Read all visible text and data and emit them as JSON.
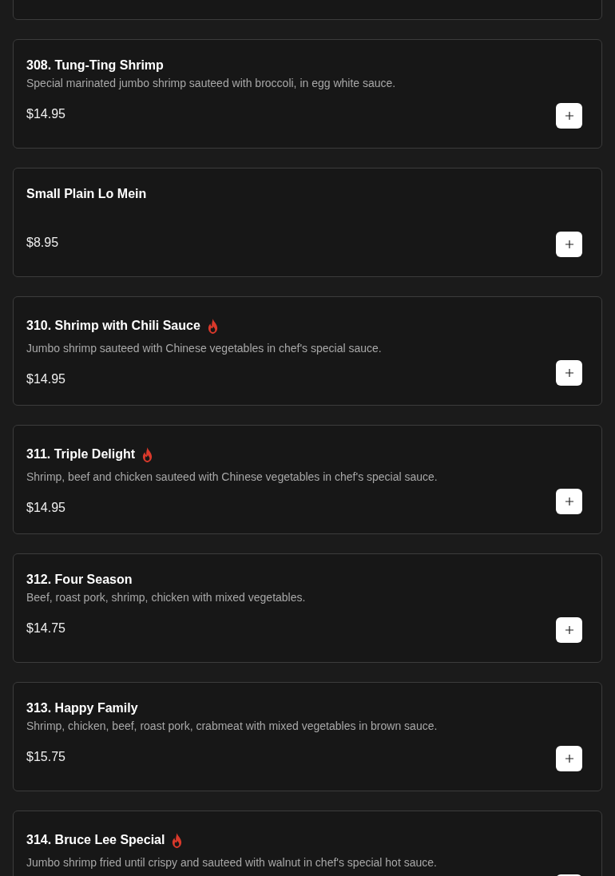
{
  "menu_items": [
    {
      "name": "308. Tung-Ting Shrimp",
      "spicy": false,
      "description": "Special marinated jumbo shrimp sauteed with broccoli, in egg white sauce.",
      "price": "$14.95"
    },
    {
      "name": "Small Plain Lo Mein",
      "spicy": false,
      "price": "$8.95"
    },
    {
      "name": "310. Shrimp with Chili Sauce",
      "spicy": true,
      "description": "Jumbo shrimp sauteed with Chinese vegetables in chef's special sauce.",
      "price": "$14.95"
    },
    {
      "name": "311. Triple Delight",
      "spicy": true,
      "description": "Shrimp, beef and chicken sauteed with Chinese vegetables in chef's special sauce.",
      "price": "$14.95"
    },
    {
      "name": "312. Four Season",
      "spicy": false,
      "description": "Beef, roast pork, shrimp, chicken with mixed vegetables.",
      "price": "$14.75"
    },
    {
      "name": "313. Happy Family",
      "spicy": false,
      "description": "Shrimp, chicken, beef, roast pork, crabmeat with mixed vegetables in brown sauce.",
      "price": "$15.75"
    },
    {
      "name": "314. Bruce Lee Special",
      "spicy": true,
      "description": "Jumbo shrimp fried until crispy and sauteed with walnut in chef's special hot sauce."
    }
  ]
}
